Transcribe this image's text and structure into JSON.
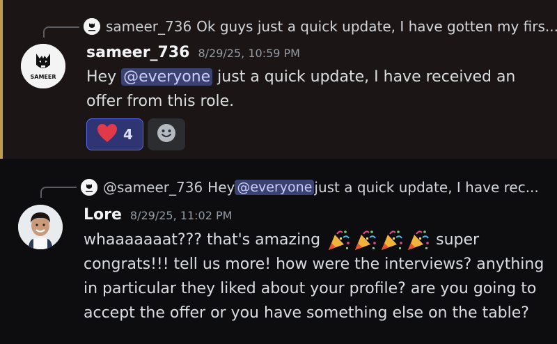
{
  "messages": [
    {
      "reply": {
        "author": "sameer_736",
        "text": "Ok guys just a quick update, I have gotten my firs..."
      },
      "avatar_text": "SAMEER",
      "author": "sameer_736",
      "timestamp": "8/29/25, 10:59 PM",
      "body": {
        "before": "Hey ",
        "mention": "@everyone",
        "line1_after": " just a quick update, I have received an",
        "line2": "offer from this role."
      },
      "reaction": {
        "emoji": "heart-emoji",
        "count": "4"
      }
    },
    {
      "reply": {
        "author": "@sameer_736",
        "before": "Hey ",
        "mention": "@everyone",
        "after": " just a quick update, I have rec..."
      },
      "author": "Lore",
      "timestamp": "8/29/25, 11:02 PM",
      "body": {
        "line1_before": "whaaaaaaat??? that's amazing",
        "line1_after": "super",
        "line2": "congrats!!! tell us more! how were the interviews? anything",
        "line3": "in particular they liked about your profile? are you going to",
        "line4": "accept the offer or you have something else on the table?"
      }
    }
  ],
  "colors": {
    "highlight_bg": "#1b1615",
    "highlight_border": "#c09a4e",
    "mention_bg": "#3c4270",
    "reaction_bg": "#2f3573"
  }
}
